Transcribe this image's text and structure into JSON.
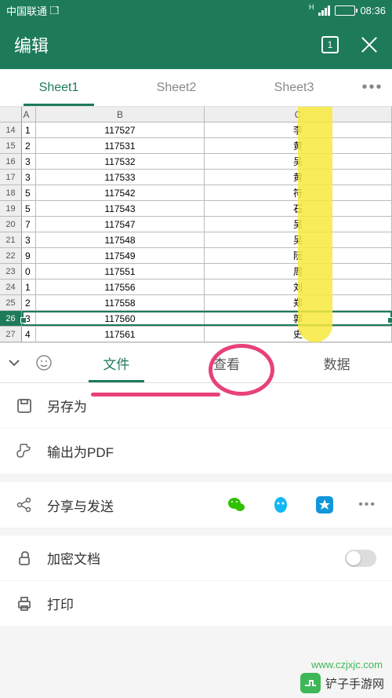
{
  "status": {
    "carrier": "中国联通",
    "time": "08:36",
    "net_indicator": "H"
  },
  "header": {
    "title": "编辑",
    "window_badge": "1"
  },
  "sheets": {
    "tabs": [
      "Sheet1",
      "Sheet2",
      "Sheet3"
    ],
    "active": 0,
    "more": "•••"
  },
  "columns": {
    "a": "A",
    "b": "B",
    "c": "C"
  },
  "rows": [
    {
      "n": "14",
      "a": "1",
      "b": "117527",
      "c": "李"
    },
    {
      "n": "15",
      "a": "2",
      "b": "117531",
      "c": "黄"
    },
    {
      "n": "16",
      "a": "3",
      "b": "117532",
      "c": "吴"
    },
    {
      "n": "17",
      "a": "3",
      "b": "117533",
      "c": "黄"
    },
    {
      "n": "18",
      "a": "5",
      "b": "117542",
      "c": "符"
    },
    {
      "n": "19",
      "a": "5",
      "b": "117543",
      "c": "石"
    },
    {
      "n": "20",
      "a": "7",
      "b": "117547",
      "c": "吴"
    },
    {
      "n": "21",
      "a": "3",
      "b": "117548",
      "c": "吴"
    },
    {
      "n": "22",
      "a": "9",
      "b": "117549",
      "c": "阮"
    },
    {
      "n": "23",
      "a": "0",
      "b": "117551",
      "c": "周"
    },
    {
      "n": "24",
      "a": "1",
      "b": "117556",
      "c": "刘"
    },
    {
      "n": "25",
      "a": "2",
      "b": "117558",
      "c": "郑"
    },
    {
      "n": "26",
      "a": "3",
      "b": "117560",
      "c": "郭"
    },
    {
      "n": "27",
      "a": "4",
      "b": "117561",
      "c": "史"
    }
  ],
  "selected_row_index": 12,
  "toolbar": {
    "tabs": {
      "file": "文件",
      "view": "查看",
      "data": "数据"
    }
  },
  "menu": {
    "save_as": "另存为",
    "export_pdf": "输出为PDF",
    "share": "分享与发送",
    "encrypt": "加密文档",
    "print": "打印",
    "more": "•••"
  },
  "colors": {
    "brand": "#1e7b5a",
    "highlight": "#f7e93d",
    "annotation": "#e8417a",
    "wechat": "#2dc100",
    "qq": "#12b7f5",
    "star": "#1296db"
  },
  "watermark": {
    "text": "铲子手游网",
    "url": "www.czjxjc.com"
  }
}
